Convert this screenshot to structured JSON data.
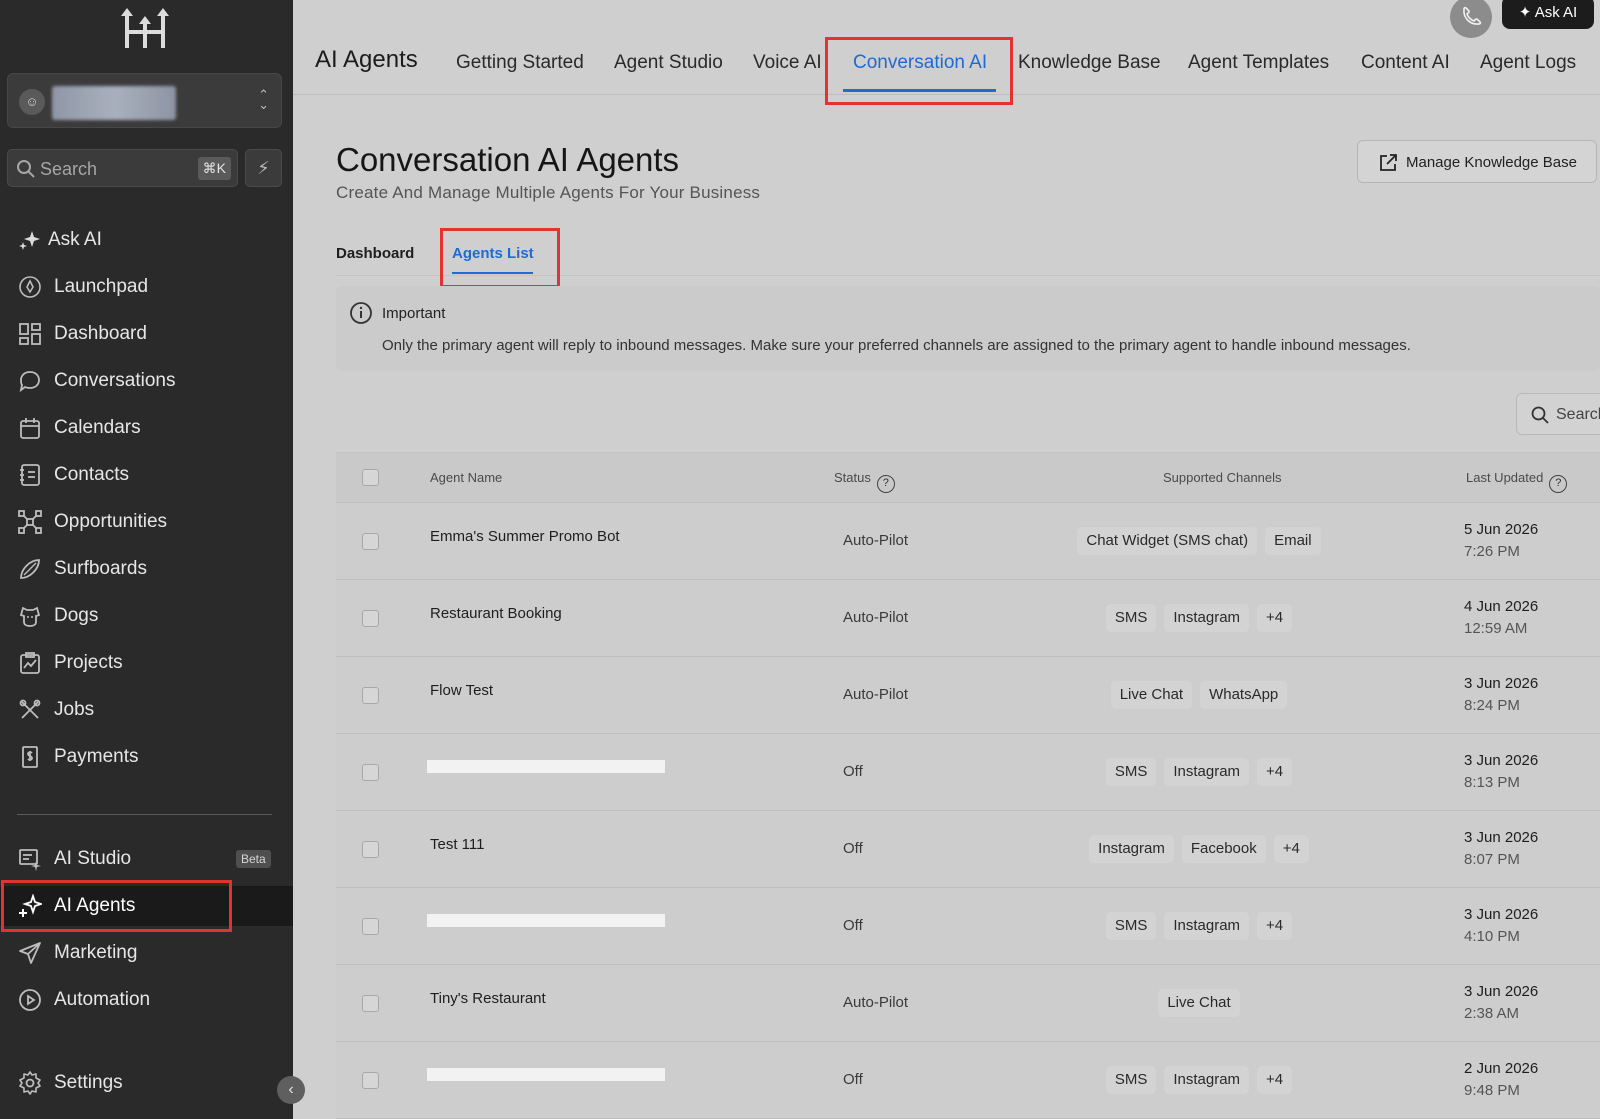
{
  "sidebar": {
    "search": {
      "placeholder": "Search",
      "shortcut": "⌘K"
    },
    "items": [
      {
        "label": "Ask AI",
        "icon": "sparkle-icon"
      },
      {
        "label": "Launchpad",
        "icon": "rocket-icon"
      },
      {
        "label": "Dashboard",
        "icon": "grid-icon"
      },
      {
        "label": "Conversations",
        "icon": "chat-bubble-icon"
      },
      {
        "label": "Calendars",
        "icon": "calendar-icon"
      },
      {
        "label": "Contacts",
        "icon": "contacts-icon"
      },
      {
        "label": "Opportunities",
        "icon": "network-icon"
      },
      {
        "label": "Surfboards",
        "icon": "surfboard-icon"
      },
      {
        "label": "Dogs",
        "icon": "dog-icon"
      },
      {
        "label": "Projects",
        "icon": "projects-icon"
      },
      {
        "label": "Jobs",
        "icon": "tools-icon"
      },
      {
        "label": "Payments",
        "icon": "receipt-icon"
      }
    ],
    "lower_items": [
      {
        "label": "AI Studio",
        "icon": "ai-studio-icon",
        "badge": "Beta"
      },
      {
        "label": "AI Agents",
        "icon": "ai-agents-icon",
        "active": true
      },
      {
        "label": "Marketing",
        "icon": "send-icon"
      },
      {
        "label": "Automation",
        "icon": "automation-icon"
      }
    ],
    "settings": {
      "label": "Settings",
      "icon": "gear-icon"
    }
  },
  "topnav": {
    "brand": "AI Agents",
    "tabs": [
      "Getting Started",
      "Agent Studio",
      "Voice AI",
      "Conversation AI",
      "Knowledge Base",
      "Agent Templates",
      "Content AI",
      "Agent Logs"
    ],
    "active_tab": "Conversation AI",
    "ask_ai": "Ask AI"
  },
  "main": {
    "title": "Conversation AI Agents",
    "subtitle": "Create And Manage Multiple Agents For Your Business",
    "manage_kb": "Manage Knowledge Base",
    "subtabs": [
      "Dashboard",
      "Agents List"
    ],
    "active_subtab": "Agents List",
    "notice": {
      "title": "Important",
      "message": "Only the primary agent will reply to inbound messages. Make sure your preferred channels are assigned to the primary agent to handle inbound messages."
    },
    "table_search_placeholder": "Search"
  },
  "table": {
    "headers": [
      "Agent Name",
      "Status",
      "Supported Channels",
      "Last Updated"
    ],
    "rows": [
      {
        "name": "Emma's Summer Promo Bot",
        "status": "Auto-Pilot",
        "channels": [
          "Chat Widget (SMS chat)",
          "Email"
        ],
        "date": "5 Jun 2026",
        "time": "7:26 PM"
      },
      {
        "name": "Restaurant Booking",
        "status": "Auto-Pilot",
        "channels": [
          "SMS",
          "Instagram",
          "+4"
        ],
        "date": "4 Jun 2026",
        "time": "12:59 AM"
      },
      {
        "name": "Flow Test",
        "status": "Auto-Pilot",
        "channels": [
          "Live Chat",
          "WhatsApp"
        ],
        "date": "3 Jun 2026",
        "time": "8:24 PM"
      },
      {
        "name": "",
        "redacted": true,
        "status": "Off",
        "channels": [
          "SMS",
          "Instagram",
          "+4"
        ],
        "date": "3 Jun 2026",
        "time": "8:13 PM"
      },
      {
        "name": "Test 111",
        "status": "Off",
        "channels": [
          "Instagram",
          "Facebook",
          "+4"
        ],
        "date": "3 Jun 2026",
        "time": "8:07 PM"
      },
      {
        "name": "",
        "redacted": true,
        "status": "Off",
        "channels": [
          "SMS",
          "Instagram",
          "+4"
        ],
        "date": "3 Jun 2026",
        "time": "4:10 PM"
      },
      {
        "name": "Tiny's Restaurant",
        "status": "Auto-Pilot",
        "channels": [
          "Live Chat"
        ],
        "date": "3 Jun 2026",
        "time": "2:38 AM"
      },
      {
        "name": "",
        "redacted": true,
        "status": "Off",
        "channels": [
          "SMS",
          "Instagram",
          "+4"
        ],
        "date": "2 Jun 2026",
        "time": "9:48 PM"
      }
    ]
  }
}
